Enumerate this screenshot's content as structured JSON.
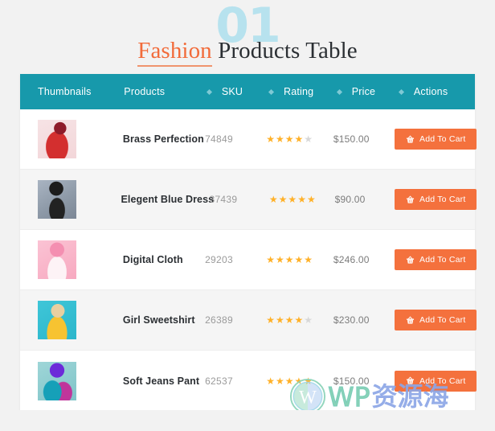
{
  "header": {
    "watermark_number": "01",
    "title_accent": "Fashion",
    "title_rest": "Products Table",
    "accent_color": "#f26b3a",
    "watermark_number_color": "#b7e2ee"
  },
  "table": {
    "header_bg": "#1799ab",
    "columns": [
      {
        "label": "Thumbnails",
        "sortable": false
      },
      {
        "label": "Products",
        "sortable": false
      },
      {
        "label": "SKU",
        "sortable": true
      },
      {
        "label": "Rating",
        "sortable": true
      },
      {
        "label": "Price",
        "sortable": true
      },
      {
        "label": "Actions",
        "sortable": true
      }
    ],
    "rows": [
      {
        "thumbnail": "woman-in-red-coat-and-red-hat",
        "product": "Brass Perfection",
        "sku": "74849",
        "rating": 4,
        "rating_max": 5,
        "price": "$150.00",
        "action_label": "Add To Cart",
        "action_icon": "shopping-basket-icon"
      },
      {
        "thumbnail": "woman-in-denim-jacket-and-black-hat",
        "product": "Elegent Blue Dress",
        "sku": "37439",
        "rating": 5,
        "rating_max": 5,
        "price": "$90.00",
        "action_label": "Add To Cart",
        "action_icon": "shopping-basket-icon"
      },
      {
        "thumbnail": "woman-with-pink-hair-on-pink-background",
        "product": "Digital Cloth",
        "sku": "29203",
        "rating": 5,
        "rating_max": 5,
        "price": "$246.00",
        "action_label": "Add To Cart",
        "action_icon": "shopping-basket-icon"
      },
      {
        "thumbnail": "woman-in-yellow-top-and-straw-hat",
        "product": "Girl Sweetshirt",
        "sku": "26389",
        "rating": 4,
        "rating_max": 5,
        "price": "$230.00",
        "action_label": "Add To Cart",
        "action_icon": "shopping-basket-icon"
      },
      {
        "thumbnail": "woman-in-purple-and-teal-jacket",
        "product": "Soft Jeans Pant",
        "sku": "62537",
        "rating": 5,
        "rating_max": 5,
        "price": "$150.00",
        "action_label": "Add To Cart",
        "action_icon": "shopping-basket-icon"
      }
    ],
    "button_color": "#f4713d",
    "star_on_color": "#ffb128",
    "star_off_color": "#d8d8d8"
  },
  "watermark": {
    "logo": "wordpress-logo",
    "text_latin": "WP",
    "text_cjk": "资源海"
  }
}
